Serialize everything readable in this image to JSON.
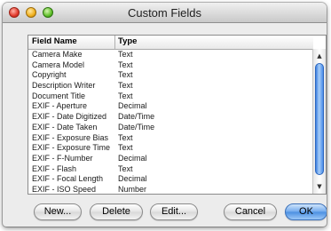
{
  "window": {
    "title": "Custom Fields"
  },
  "table": {
    "columns": [
      "Field Name",
      "Type"
    ],
    "rows": [
      [
        "Camera Make",
        "Text"
      ],
      [
        "Camera Model",
        "Text"
      ],
      [
        "Copyright",
        "Text"
      ],
      [
        "Description Writer",
        "Text"
      ],
      [
        "Document Title",
        "Text"
      ],
      [
        "EXIF - Aperture",
        "Decimal"
      ],
      [
        "EXIF - Date Digitized",
        "Date/Time"
      ],
      [
        "EXIF - Date Taken",
        "Date/Time"
      ],
      [
        "EXIF - Exposure Bias",
        "Text"
      ],
      [
        "EXIF - Exposure Time",
        "Text"
      ],
      [
        "EXIF - F-Number",
        "Decimal"
      ],
      [
        "EXIF - Flash",
        "Text"
      ],
      [
        "EXIF - Focal Length",
        "Decimal"
      ],
      [
        "EXIF - ISO Speed",
        "Number"
      ]
    ]
  },
  "buttons": {
    "new": "New...",
    "delete": "Delete",
    "edit": "Edit...",
    "cancel": "Cancel",
    "ok": "OK"
  }
}
